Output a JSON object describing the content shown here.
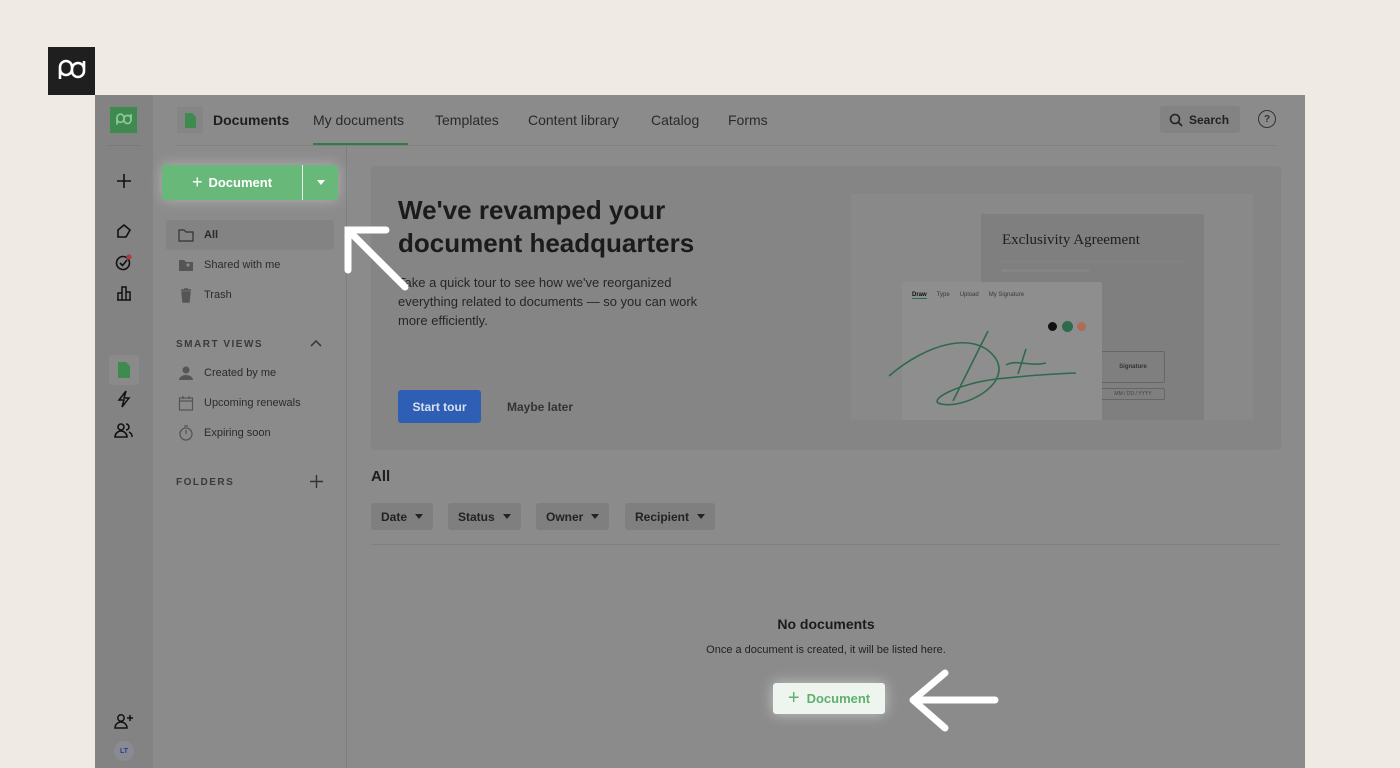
{
  "brand": {
    "logo_text": "pd"
  },
  "header": {
    "section_title": "Documents",
    "tabs": [
      {
        "label": "My documents",
        "active": true
      },
      {
        "label": "Templates"
      },
      {
        "label": "Content library"
      },
      {
        "label": "Catalog"
      },
      {
        "label": "Forms"
      }
    ],
    "search_label": "Search"
  },
  "sidebar": {
    "new_button": "Document",
    "items": [
      {
        "label": "All",
        "active": true
      },
      {
        "label": "Shared with me"
      },
      {
        "label": "Trash"
      }
    ],
    "smart_views": {
      "title": "SMART VIEWS",
      "items": [
        {
          "label": "Created by me"
        },
        {
          "label": "Upcoming renewals"
        },
        {
          "label": "Expiring soon"
        }
      ]
    },
    "folders": {
      "title": "FOLDERS"
    }
  },
  "rail": {
    "avatar_initials": "LT"
  },
  "hero": {
    "title": "We've revamped your document headquarters",
    "body": "Take a quick tour to see how we've reorganized everything related to documents — so you can work more efficiently.",
    "primary": "Start tour",
    "secondary": "Maybe later",
    "illustration": {
      "doc_title": "Exclusivity Agreement",
      "sig_tabs": [
        "Draw",
        "Type",
        "Upload",
        "My Signature"
      ],
      "signature_field": "Signature",
      "date_field": "MM / DD / YYYY"
    }
  },
  "list": {
    "title": "All",
    "filters": [
      "Date",
      "Status",
      "Owner",
      "Recipient"
    ],
    "empty_title": "No documents",
    "empty_body": "Once a document is created, it will be listed here.",
    "empty_button": "Document"
  },
  "colors": {
    "accent": "#68b87a",
    "primary_button": "#2f5fb4",
    "background": "#efeae4",
    "overlay": "#8b8b8b"
  }
}
